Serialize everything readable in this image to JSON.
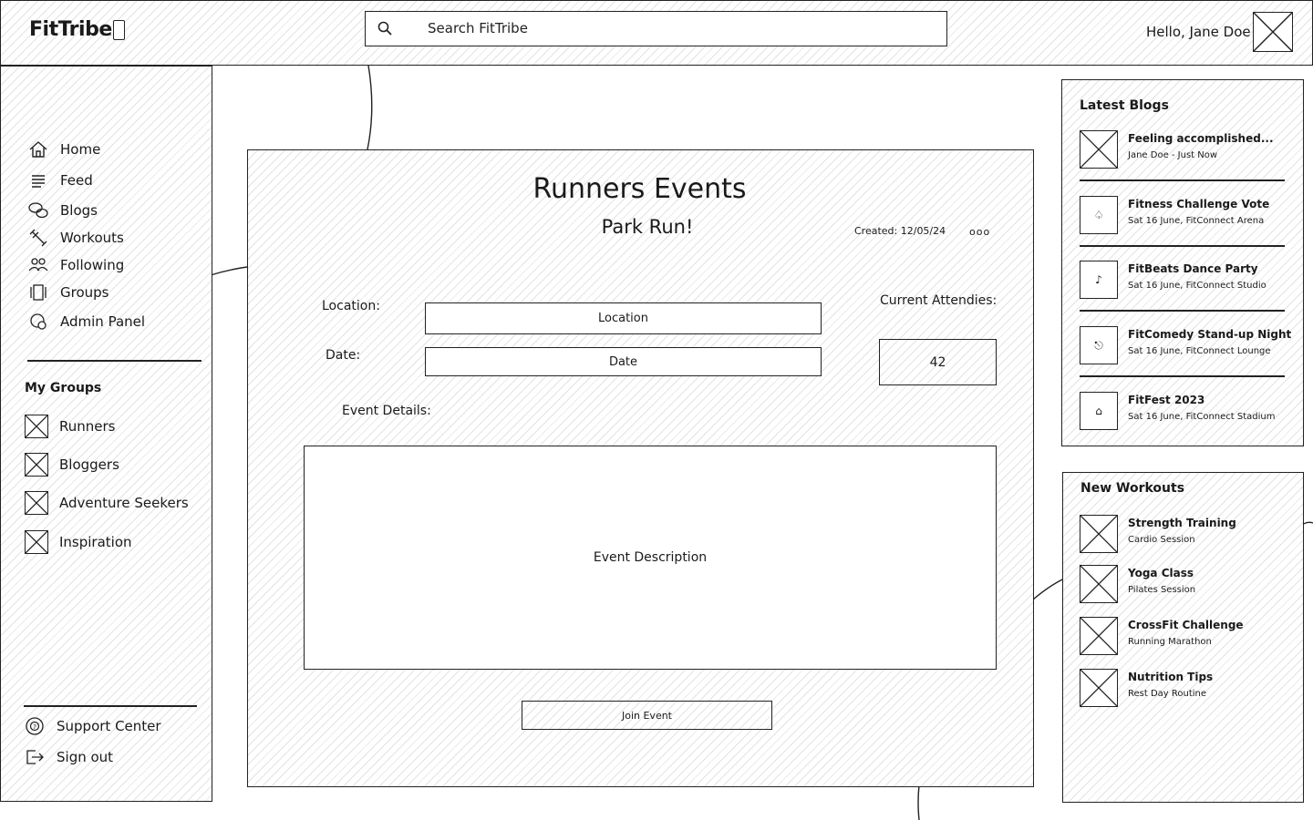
{
  "header": {
    "logo": "FitTribe",
    "search_placeholder": "Search FitTribe",
    "greeting": "Hello, Jane Doe"
  },
  "sidebar": {
    "nav": [
      {
        "label": "Home",
        "icon": "home-icon"
      },
      {
        "label": "Feed",
        "icon": "feed-icon"
      },
      {
        "label": "Blogs",
        "icon": "chat-bubbles-icon"
      },
      {
        "label": "Workouts",
        "icon": "dumbbell-icon"
      },
      {
        "label": "Following",
        "icon": "people-icon"
      },
      {
        "label": "Groups",
        "icon": "groups-icon"
      },
      {
        "label": "Admin Panel",
        "icon": "admin-gear-icon"
      }
    ],
    "my_groups_title": "My Groups",
    "groups": [
      "Runners",
      "Bloggers",
      "Adventure Seekers",
      "Inspiration"
    ],
    "footer": [
      {
        "label": "Support Center",
        "icon": "help-icon"
      },
      {
        "label": "Sign out",
        "icon": "sign-out-icon"
      }
    ]
  },
  "main": {
    "title": "Runners Events",
    "event_name": "Park Run!",
    "created": "Created: 12/05/24",
    "more": "ooo",
    "location_label": "Location:",
    "location_value": "Location",
    "date_label": "Date:",
    "date_value": "Date",
    "attendees_label": "Current Attendies:",
    "attendees_count": "42",
    "details_label": "Event Details:",
    "description": "Event Description",
    "join_button": "Join Event"
  },
  "latest_blogs": {
    "title": "Latest Blogs",
    "items": [
      {
        "title": "Feeling accomplished...",
        "sub": "Jane Doe - Just Now",
        "thumb": "placeholder-image-icon"
      },
      {
        "title": "Fitness Challenge Vote",
        "sub": "Sat 16 June, FitConnect Arena",
        "thumb": "trophy-icon"
      },
      {
        "title": "FitBeats Dance Party",
        "sub": "Sat 16 June, FitConnect Studio",
        "thumb": "music-note-icon"
      },
      {
        "title": "FitComedy Stand-up Night",
        "sub": "Sat 16 June, FitConnect Lounge",
        "thumb": "microphone-icon"
      },
      {
        "title": "FitFest 2023",
        "sub": "Sat 16 June, FitConnect Stadium",
        "thumb": "tent-icon"
      }
    ]
  },
  "new_workouts": {
    "title": "New Workouts",
    "items": [
      {
        "title": "Strength Training",
        "sub": "Cardio Session"
      },
      {
        "title": "Yoga Class",
        "sub": "Pilates Session"
      },
      {
        "title": "CrossFit Challenge",
        "sub": "Running Marathon"
      },
      {
        "title": "Nutrition Tips",
        "sub": "Rest Day Routine"
      }
    ]
  }
}
